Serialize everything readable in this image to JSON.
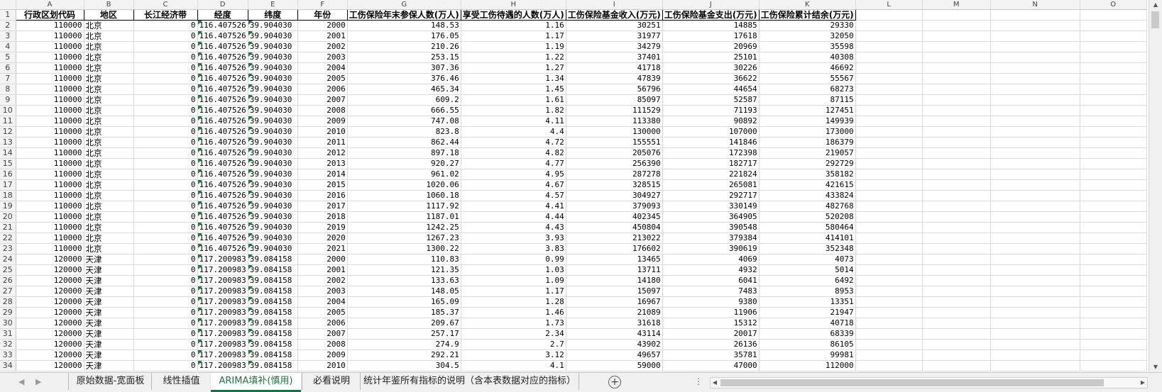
{
  "columns": [
    "A",
    "B",
    "C",
    "D",
    "E",
    "F",
    "G",
    "H",
    "I",
    "J",
    "K",
    "L",
    "M",
    "N",
    "O"
  ],
  "headers": [
    "行政区划代码",
    "地区",
    "长江经济带",
    "经度",
    "纬度",
    "年份",
    "工伤保险年末参保人数(万人)",
    "享受工伤待遇的人数(万人)",
    "工伤保险基金收入(万元)",
    "工伤保险基金支出(万元)",
    "工伤保险累计结余(万元)"
  ],
  "rows": [
    {
      "n": "2",
      "code": "110000",
      "region": "北京",
      "yz": "0",
      "lon": "116.407526",
      "lat": "39.904030",
      "year": "2000",
      "g": "148.53",
      "h": "1.16",
      "i": "30251",
      "j": "14885",
      "k": "29330"
    },
    {
      "n": "3",
      "code": "110000",
      "region": "北京",
      "yz": "0",
      "lon": "116.407526",
      "lat": "39.904030",
      "year": "2001",
      "g": "176.05",
      "h": "1.17",
      "i": "31977",
      "j": "17618",
      "k": "32050"
    },
    {
      "n": "4",
      "code": "110000",
      "region": "北京",
      "yz": "0",
      "lon": "116.407526",
      "lat": "39.904030",
      "year": "2002",
      "g": "210.26",
      "h": "1.19",
      "i": "34279",
      "j": "20969",
      "k": "35598"
    },
    {
      "n": "5",
      "code": "110000",
      "region": "北京",
      "yz": "0",
      "lon": "116.407526",
      "lat": "39.904030",
      "year": "2003",
      "g": "253.15",
      "h": "1.22",
      "i": "37401",
      "j": "25101",
      "k": "40308"
    },
    {
      "n": "6",
      "code": "110000",
      "region": "北京",
      "yz": "0",
      "lon": "116.407526",
      "lat": "39.904030",
      "year": "2004",
      "g": "307.36",
      "h": "1.27",
      "i": "41718",
      "j": "30226",
      "k": "46692"
    },
    {
      "n": "7",
      "code": "110000",
      "region": "北京",
      "yz": "0",
      "lon": "116.407526",
      "lat": "39.904030",
      "year": "2005",
      "g": "376.46",
      "h": "1.34",
      "i": "47839",
      "j": "36622",
      "k": "55567"
    },
    {
      "n": "8",
      "code": "110000",
      "region": "北京",
      "yz": "0",
      "lon": "116.407526",
      "lat": "39.904030",
      "year": "2006",
      "g": "465.34",
      "h": "1.45",
      "i": "56796",
      "j": "44654",
      "k": "68273"
    },
    {
      "n": "9",
      "code": "110000",
      "region": "北京",
      "yz": "0",
      "lon": "116.407526",
      "lat": "39.904030",
      "year": "2007",
      "g": "609.2",
      "h": "1.61",
      "i": "85097",
      "j": "52587",
      "k": "87115"
    },
    {
      "n": "10",
      "code": "110000",
      "region": "北京",
      "yz": "0",
      "lon": "116.407526",
      "lat": "39.904030",
      "year": "2008",
      "g": "666.55",
      "h": "1.82",
      "i": "111529",
      "j": "71193",
      "k": "127451"
    },
    {
      "n": "11",
      "code": "110000",
      "region": "北京",
      "yz": "0",
      "lon": "116.407526",
      "lat": "39.904030",
      "year": "2009",
      "g": "747.08",
      "h": "4.11",
      "i": "113380",
      "j": "90892",
      "k": "149939"
    },
    {
      "n": "12",
      "code": "110000",
      "region": "北京",
      "yz": "0",
      "lon": "116.407526",
      "lat": "39.904030",
      "year": "2010",
      "g": "823.8",
      "h": "4.4",
      "i": "130000",
      "j": "107000",
      "k": "173000"
    },
    {
      "n": "13",
      "code": "110000",
      "region": "北京",
      "yz": "0",
      "lon": "116.407526",
      "lat": "39.904030",
      "year": "2011",
      "g": "862.44",
      "h": "4.72",
      "i": "155551",
      "j": "141846",
      "k": "186379"
    },
    {
      "n": "14",
      "code": "110000",
      "region": "北京",
      "yz": "0",
      "lon": "116.407526",
      "lat": "39.904030",
      "year": "2012",
      "g": "897.18",
      "h": "4.82",
      "i": "205076",
      "j": "172398",
      "k": "219057"
    },
    {
      "n": "15",
      "code": "110000",
      "region": "北京",
      "yz": "0",
      "lon": "116.407526",
      "lat": "39.904030",
      "year": "2013",
      "g": "920.27",
      "h": "4.77",
      "i": "256390",
      "j": "182717",
      "k": "292729"
    },
    {
      "n": "16",
      "code": "110000",
      "region": "北京",
      "yz": "0",
      "lon": "116.407526",
      "lat": "39.904030",
      "year": "2014",
      "g": "961.02",
      "h": "4.95",
      "i": "287278",
      "j": "221824",
      "k": "358182"
    },
    {
      "n": "17",
      "code": "110000",
      "region": "北京",
      "yz": "0",
      "lon": "116.407526",
      "lat": "39.904030",
      "year": "2015",
      "g": "1020.06",
      "h": "4.67",
      "i": "328515",
      "j": "265081",
      "k": "421615"
    },
    {
      "n": "18",
      "code": "110000",
      "region": "北京",
      "yz": "0",
      "lon": "116.407526",
      "lat": "39.904030",
      "year": "2016",
      "g": "1060.18",
      "h": "4.57",
      "i": "304927",
      "j": "292717",
      "k": "433824"
    },
    {
      "n": "19",
      "code": "110000",
      "region": "北京",
      "yz": "0",
      "lon": "116.407526",
      "lat": "39.904030",
      "year": "2017",
      "g": "1117.92",
      "h": "4.41",
      "i": "379093",
      "j": "330149",
      "k": "482768"
    },
    {
      "n": "20",
      "code": "110000",
      "region": "北京",
      "yz": "0",
      "lon": "116.407526",
      "lat": "39.904030",
      "year": "2018",
      "g": "1187.01",
      "h": "4.44",
      "i": "402345",
      "j": "364905",
      "k": "520208"
    },
    {
      "n": "21",
      "code": "110000",
      "region": "北京",
      "yz": "0",
      "lon": "116.407526",
      "lat": "39.904030",
      "year": "2019",
      "g": "1242.25",
      "h": "4.43",
      "i": "450804",
      "j": "390548",
      "k": "580464"
    },
    {
      "n": "22",
      "code": "110000",
      "region": "北京",
      "yz": "0",
      "lon": "116.407526",
      "lat": "39.904030",
      "year": "2020",
      "g": "1267.23",
      "h": "3.93",
      "i": "213022",
      "j": "379384",
      "k": "414101"
    },
    {
      "n": "23",
      "code": "110000",
      "region": "北京",
      "yz": "0",
      "lon": "116.407526",
      "lat": "39.904030",
      "year": "2021",
      "g": "1300.22",
      "h": "3.83",
      "i": "176602",
      "j": "390619",
      "k": "352348"
    },
    {
      "n": "24",
      "code": "120000",
      "region": "天津",
      "yz": "0",
      "lon": "117.200983",
      "lat": "39.084158",
      "year": "2000",
      "g": "110.83",
      "h": "0.99",
      "i": "13465",
      "j": "4069",
      "k": "4073"
    },
    {
      "n": "25",
      "code": "120000",
      "region": "天津",
      "yz": "0",
      "lon": "117.200983",
      "lat": "39.084158",
      "year": "2001",
      "g": "121.35",
      "h": "1.03",
      "i": "13711",
      "j": "4932",
      "k": "5014"
    },
    {
      "n": "26",
      "code": "120000",
      "region": "天津",
      "yz": "0",
      "lon": "117.200983",
      "lat": "39.084158",
      "year": "2002",
      "g": "133.63",
      "h": "1.09",
      "i": "14180",
      "j": "6041",
      "k": "6492"
    },
    {
      "n": "27",
      "code": "120000",
      "region": "天津",
      "yz": "0",
      "lon": "117.200983",
      "lat": "39.084158",
      "year": "2003",
      "g": "148.05",
      "h": "1.17",
      "i": "15097",
      "j": "7483",
      "k": "8953"
    },
    {
      "n": "28",
      "code": "120000",
      "region": "天津",
      "yz": "0",
      "lon": "117.200983",
      "lat": "39.084158",
      "year": "2004",
      "g": "165.09",
      "h": "1.28",
      "i": "16967",
      "j": "9380",
      "k": "13351"
    },
    {
      "n": "29",
      "code": "120000",
      "region": "天津",
      "yz": "0",
      "lon": "117.200983",
      "lat": "39.084158",
      "year": "2005",
      "g": "185.37",
      "h": "1.46",
      "i": "21089",
      "j": "11906",
      "k": "21947"
    },
    {
      "n": "30",
      "code": "120000",
      "region": "天津",
      "yz": "0",
      "lon": "117.200983",
      "lat": "39.084158",
      "year": "2006",
      "g": "209.67",
      "h": "1.73",
      "i": "31618",
      "j": "15312",
      "k": "40718"
    },
    {
      "n": "31",
      "code": "120000",
      "region": "天津",
      "yz": "0",
      "lon": "117.200983",
      "lat": "39.084158",
      "year": "2007",
      "g": "257.17",
      "h": "2.34",
      "i": "43114",
      "j": "20017",
      "k": "68339"
    },
    {
      "n": "32",
      "code": "120000",
      "region": "天津",
      "yz": "0",
      "lon": "117.200983",
      "lat": "39.084158",
      "year": "2008",
      "g": "274.9",
      "h": "2.7",
      "i": "43902",
      "j": "26136",
      "k": "86105"
    },
    {
      "n": "33",
      "code": "120000",
      "region": "天津",
      "yz": "0",
      "lon": "117.200983",
      "lat": "39.084158",
      "year": "2009",
      "g": "292.21",
      "h": "3.12",
      "i": "49657",
      "j": "35781",
      "k": "99981"
    },
    {
      "n": "34",
      "code": "120000",
      "region": "天津",
      "yz": "0",
      "lon": "117.200983",
      "lat": "39.084158",
      "year": "2010",
      "g": "304.5",
      "h": "4.1",
      "i": "59000",
      "j": "47000",
      "k": "112000"
    }
  ],
  "tabs": [
    {
      "label": "原始数据-宽面板",
      "active": false
    },
    {
      "label": "线性插值",
      "active": false
    },
    {
      "label": "ARIMA填补(慎用)",
      "active": true
    },
    {
      "label": "必看说明",
      "active": false
    },
    {
      "label": "统计年鉴所有指标的说明（含本表数据对应的指标）",
      "active": false
    }
  ],
  "colors": {
    "active_tab": "#1e7145",
    "triangle": "#1f7a3a",
    "header_bg": "#f3f3f3"
  },
  "icons": {
    "add_sheet": "plus-circle-icon",
    "more": "ellipsis-icon"
  }
}
